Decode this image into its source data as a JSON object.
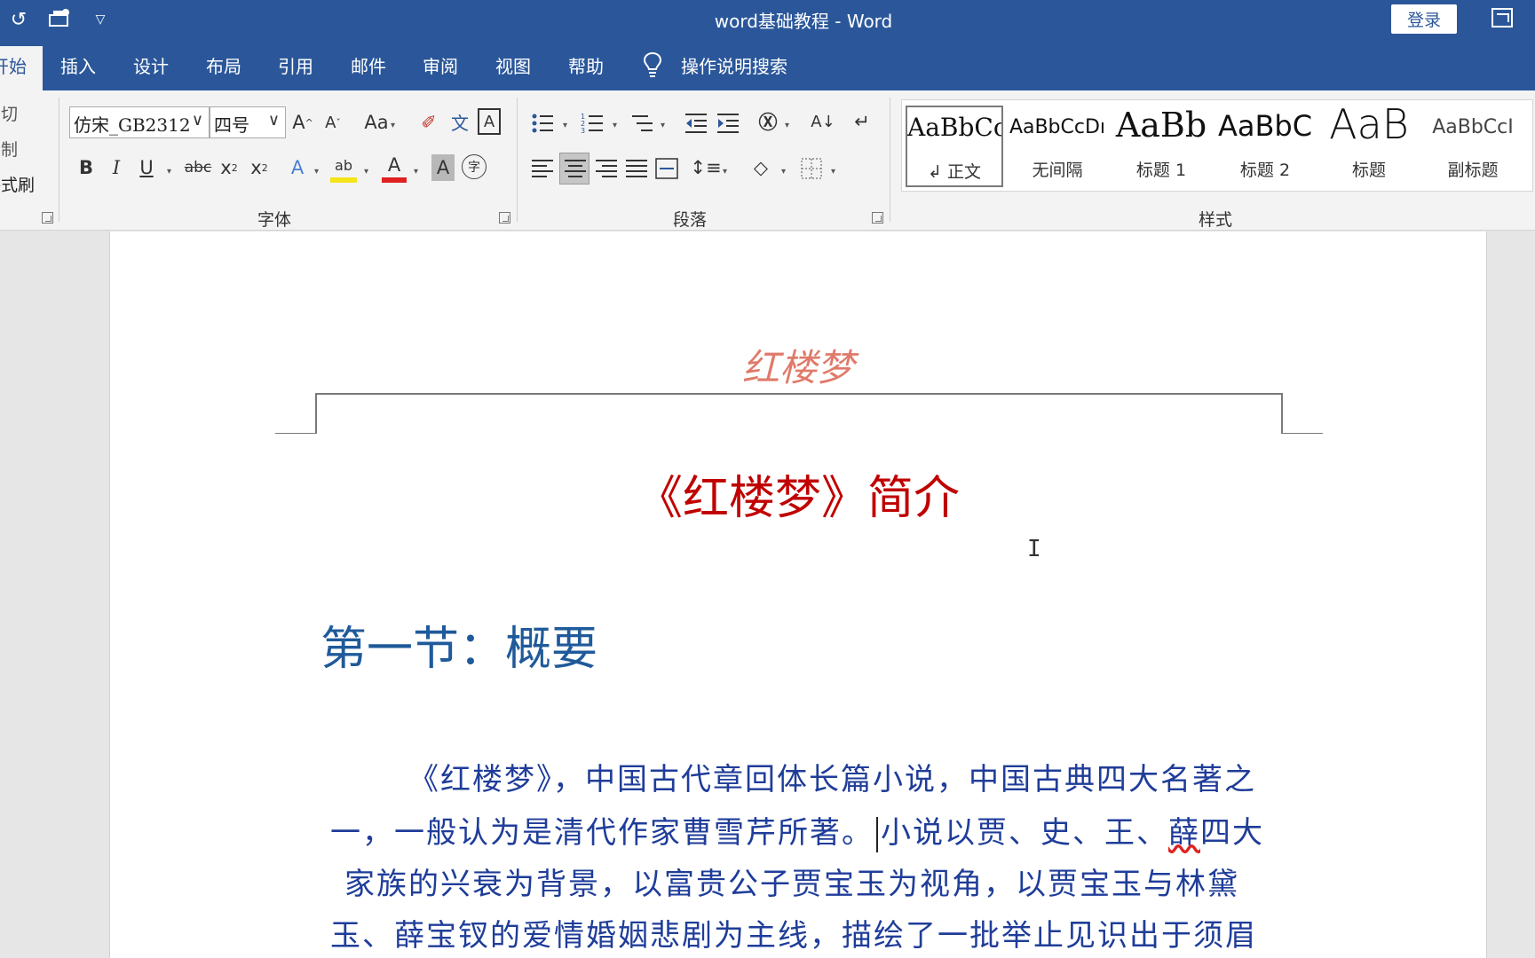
{
  "titlebar": {
    "title": "word基础教程  -  Word",
    "login": "登录"
  },
  "tabs": [
    {
      "label": "开始"
    },
    {
      "label": "插入"
    },
    {
      "label": "设计"
    },
    {
      "label": "布局"
    },
    {
      "label": "引用"
    },
    {
      "label": "邮件"
    },
    {
      "label": "审阅"
    },
    {
      "label": "视图"
    },
    {
      "label": "帮助"
    }
  ],
  "tell_me": "操作说明搜索",
  "clipboard": {
    "cut": "剪切",
    "copy": "复制",
    "painter": "格式刷"
  },
  "font_group": {
    "label": "字体",
    "font_name": "仿宋_GB2312",
    "font_size": "四号",
    "grow": "A",
    "shrink": "A",
    "change_case": "Aa",
    "phonetic": "文",
    "char_border": "A",
    "bold": "B",
    "italic": "I",
    "underline": "U",
    "strike": "abc",
    "subscript": "x",
    "superscript": "x",
    "text_effects": "A",
    "highlight": "ab",
    "font_color": "A",
    "char_shading": "A",
    "enclose": "字"
  },
  "paragraph_group": {
    "label": "段落"
  },
  "styles_group": {
    "label": "样式",
    "items": [
      {
        "preview": "AaBbCc",
        "name": "正文",
        "selected": true
      },
      {
        "preview": "AaBbCcDı",
        "name": "无间隔"
      },
      {
        "preview": "AaBb",
        "name": "标题 1"
      },
      {
        "preview": "AaBbC",
        "name": "标题 2"
      },
      {
        "preview": "AaB",
        "name": "标题"
      },
      {
        "preview": "AaBbCcI",
        "name": "副标题"
      }
    ]
  },
  "document": {
    "header": "红楼梦",
    "title": "《红楼梦》简介",
    "heading": "第一节：概要",
    "para_lines": [
      "《红楼梦》，中国古代章回体长篇小说，中国古典四大名著之",
      "一，一般认为是清代作家曹雪芹所著。",
      "小说以贾、史、王、",
      "薛",
      "四大",
      "家族的兴衰为背景，以富贵公子贾宝玉为视角，以贾宝玉与林黛",
      "玉、薛宝钗的爱情婚姻悲剧为主线，描绘了一批举止见识出于须眉"
    ]
  },
  "colors": {
    "titlebar": "#2b579a",
    "ribbon": "#f3f3f3",
    "doc_title": "#c00000",
    "header_text": "#e07a6a",
    "heading": "#1f5a9a",
    "body_text": "#1f3d99"
  }
}
